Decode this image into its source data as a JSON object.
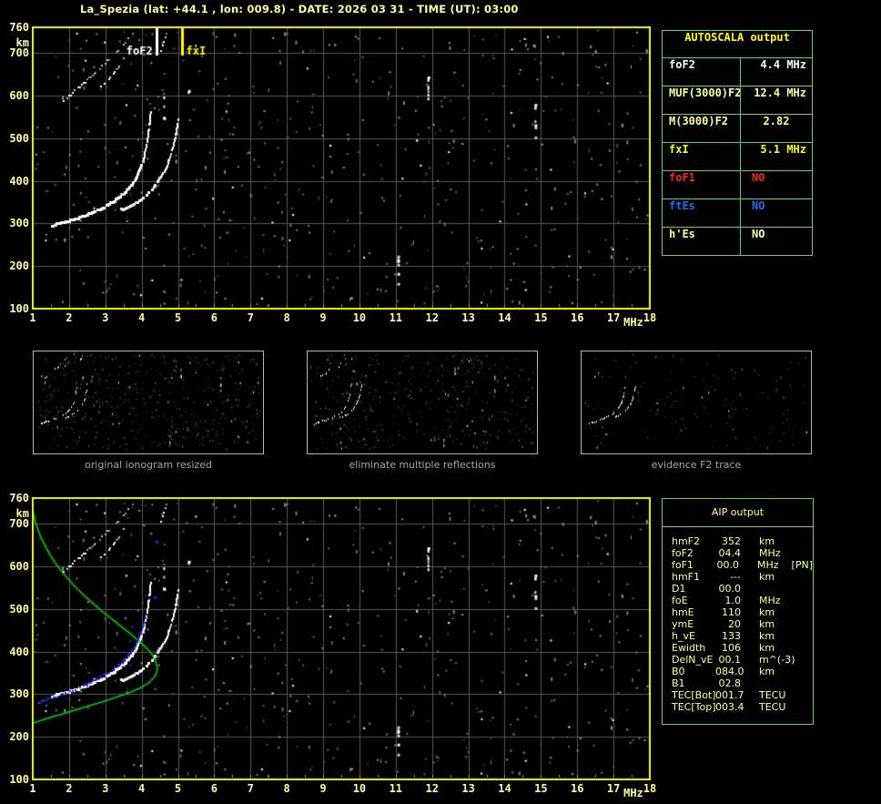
{
  "header": {
    "title": "La_Spezia (lat: +44.1 , lon: 009.8) - DATE: 2026 03 31 - TIME (UT): 03:00"
  },
  "colors": {
    "background": "#000000",
    "pale_yellow": "#ffff9c",
    "bright_yellow": "#ffff00",
    "plot_border": "#f2f200",
    "grid": "#575757",
    "table_border": "#5cd65c",
    "caption_text": "#a8a8a8",
    "white": "#ffffff",
    "red": "#ff2020",
    "blue": "#1e6eff",
    "profile_green": "#00cf00",
    "restored_blue": "#2b2bff",
    "tick_gray": "#9a9a9a"
  },
  "axes": {
    "x_ticks": [
      "1",
      "2",
      "3",
      "4",
      "5",
      "6",
      "7",
      "8",
      "9",
      "10",
      "11",
      "12",
      "13",
      "14",
      "15",
      "16",
      "17",
      "18"
    ],
    "x_unit": "MHz",
    "y_ticks": [
      "760",
      "700",
      "600",
      "500",
      "400",
      "300",
      "200",
      "100"
    ],
    "y_unit": "km",
    "x_range_mhz": [
      1,
      18
    ],
    "y_range_km": [
      100,
      760
    ]
  },
  "top_plot": {
    "foF2_marker": {
      "label": "foF2",
      "freq": 4.4,
      "color": "#ffffff"
    },
    "fxI_marker": {
      "label": "fxI",
      "freq": 5.1,
      "color": "#ffff00"
    }
  },
  "autoscala_table": {
    "title": "AUTOSCALA output",
    "rows": [
      {
        "label": "foF2",
        "value": "4.4 MHz",
        "color": "#ffffff"
      },
      {
        "label": "MUF(3000)F2",
        "value": "12.4 MHz",
        "color": "#ffff9c"
      },
      {
        "label": "M(3000)F2",
        "value": "2.82",
        "color": "#ffff9c"
      },
      {
        "label": "fxI",
        "value": "5.1 MHz",
        "color": "#ffff00"
      },
      {
        "label": "foF1",
        "value": "NO",
        "color": "#ff2020"
      },
      {
        "label": "ftEs",
        "value": "NO",
        "color": "#1e6eff"
      },
      {
        "label": "h'Es",
        "value": "NO",
        "color": "#ffff9c"
      }
    ]
  },
  "aip_table": {
    "title": "AIP output",
    "rows": [
      {
        "label": "hmF2",
        "value": "352",
        "unit": "km",
        "extra": ""
      },
      {
        "label": "foF2",
        "value": "04.4",
        "unit": "MHz",
        "extra": ""
      },
      {
        "label": "foF1",
        "value": "00.0",
        "unit": "MHz",
        "extra": "[PN]"
      },
      {
        "label": "hmF1",
        "value": "---",
        "unit": "km",
        "extra": ""
      },
      {
        "label": "D1",
        "value": "00.0",
        "unit": "",
        "extra": ""
      },
      {
        "label": "foE",
        "value": "1.0",
        "unit": "MHz",
        "extra": ""
      },
      {
        "label": "hmE",
        "value": "110",
        "unit": "km",
        "extra": ""
      },
      {
        "label": "ymE",
        "value": "20",
        "unit": "km",
        "extra": ""
      },
      {
        "label": "h_vE",
        "value": "133",
        "unit": "km",
        "extra": ""
      },
      {
        "label": "Ewidth",
        "value": "106",
        "unit": "km",
        "extra": ""
      },
      {
        "label": "DelN_vE",
        "value": "00.1",
        "unit": "m^(-3)",
        "extra": ""
      },
      {
        "label": "B0",
        "value": "084.0",
        "unit": "km",
        "extra": ""
      },
      {
        "label": "B1",
        "value": "02.8",
        "unit": "",
        "extra": ""
      },
      {
        "label": "TEC[Bot]",
        "value": "001.7",
        "unit": "TECU",
        "extra": ""
      },
      {
        "label": "TEC[Top]",
        "value": "003.4",
        "unit": "TECU",
        "extra": ""
      }
    ]
  },
  "thumbnails": [
    {
      "caption": "original ionogram resized"
    },
    {
      "caption": "eliminate multiple reflections"
    },
    {
      "caption": "evidence F2 trace"
    }
  ],
  "chart_data": {
    "type": "scatter",
    "x_range_mhz": [
      1,
      18
    ],
    "y_range_km": [
      100,
      760
    ],
    "o_trace": [
      [
        1.55,
        295
      ],
      [
        1.75,
        299
      ],
      [
        2.0,
        305
      ],
      [
        2.25,
        312
      ],
      [
        2.5,
        320
      ],
      [
        2.75,
        329
      ],
      [
        3.0,
        340
      ],
      [
        3.2,
        350
      ],
      [
        3.4,
        362
      ],
      [
        3.6,
        377
      ],
      [
        3.75,
        392
      ],
      [
        3.88,
        410
      ],
      [
        3.98,
        430
      ],
      [
        4.06,
        452
      ],
      [
        4.12,
        475
      ],
      [
        4.17,
        500
      ],
      [
        4.21,
        525
      ],
      [
        4.24,
        548
      ],
      [
        4.26,
        565
      ]
    ],
    "x_trace": [
      [
        3.4,
        330
      ],
      [
        3.6,
        337
      ],
      [
        3.8,
        346
      ],
      [
        4.0,
        357
      ],
      [
        4.2,
        371
      ],
      [
        4.38,
        388
      ],
      [
        4.54,
        408
      ],
      [
        4.68,
        430
      ],
      [
        4.79,
        455
      ],
      [
        4.88,
        482
      ],
      [
        4.94,
        508
      ],
      [
        4.99,
        533
      ],
      [
        5.03,
        555
      ]
    ],
    "multiples": [
      {
        "points": [
          [
            1.85,
            588
          ],
          [
            2.1,
            606
          ],
          [
            2.35,
            625
          ],
          [
            2.6,
            644
          ],
          [
            2.85,
            664
          ],
          [
            3.1,
            685
          ],
          [
            3.35,
            706
          ],
          [
            3.6,
            728
          ],
          [
            3.8,
            748
          ]
        ],
        "bright_frac": 0.3,
        "density": 0.7
      },
      {
        "points": [
          [
            2.85,
            615
          ],
          [
            3.1,
            640
          ],
          [
            3.35,
            666
          ],
          [
            3.6,
            693
          ],
          [
            3.85,
            721
          ],
          [
            4.1,
            750
          ]
        ],
        "bright_frac": 0.35,
        "density": 0.55
      },
      {
        "points": [
          [
            4.45,
            690
          ],
          [
            4.55,
            712
          ],
          [
            4.65,
            735
          ],
          [
            4.72,
            755
          ]
        ],
        "bright_frac": 0.5,
        "density": 0.6
      }
    ],
    "clusters": [
      {
        "f": 11.9,
        "h1": 593,
        "h2": 657,
        "n": 8
      },
      {
        "f": 14.85,
        "h1": 498,
        "h2": 610,
        "n": 9
      },
      {
        "f": 11.07,
        "h1": 150,
        "h2": 233,
        "n": 8
      },
      {
        "f": 4.62,
        "h1": 545,
        "h2": 605,
        "n": 4
      },
      {
        "f": 5.3,
        "h1": 595,
        "h2": 615,
        "n": 2
      }
    ],
    "profile_green": [
      [
        1.0,
        731
      ],
      [
        1.08,
        702
      ],
      [
        1.2,
        672
      ],
      [
        1.38,
        641
      ],
      [
        1.6,
        610
      ],
      [
        1.88,
        579
      ],
      [
        2.2,
        549
      ],
      [
        2.55,
        521
      ],
      [
        2.92,
        494
      ],
      [
        3.3,
        468
      ],
      [
        3.67,
        443
      ],
      [
        4.0,
        419
      ],
      [
        4.25,
        398
      ],
      [
        4.38,
        380
      ],
      [
        4.43,
        362
      ],
      [
        4.42,
        352
      ],
      [
        4.36,
        341
      ],
      [
        4.22,
        328
      ],
      [
        3.98,
        315
      ],
      [
        3.65,
        303
      ],
      [
        3.28,
        292
      ],
      [
        2.88,
        281
      ],
      [
        2.48,
        271
      ],
      [
        2.1,
        261
      ],
      [
        1.76,
        252
      ],
      [
        1.47,
        245
      ],
      [
        1.24,
        239
      ],
      [
        1.08,
        234
      ],
      [
        1.0,
        232
      ]
    ],
    "restored_trace_blue": [
      [
        1.15,
        280
      ],
      [
        1.3,
        284
      ],
      [
        1.5,
        289
      ],
      [
        1.7,
        295
      ],
      [
        1.9,
        301
      ],
      [
        2.1,
        308
      ],
      [
        2.3,
        315
      ],
      [
        2.5,
        323
      ],
      [
        2.7,
        332
      ],
      [
        2.9,
        341
      ],
      [
        3.1,
        352
      ],
      [
        3.3,
        364
      ],
      [
        3.5,
        378
      ],
      [
        3.67,
        393
      ],
      [
        3.8,
        409
      ],
      [
        3.9,
        426
      ],
      [
        3.99,
        444
      ],
      [
        4.06,
        461
      ],
      [
        4.12,
        477
      ],
      [
        4.17,
        490
      ]
    ],
    "restored_markers_blue": [
      [
        1.0,
        402
      ],
      [
        4.35,
        528
      ],
      [
        4.42,
        658
      ]
    ]
  }
}
